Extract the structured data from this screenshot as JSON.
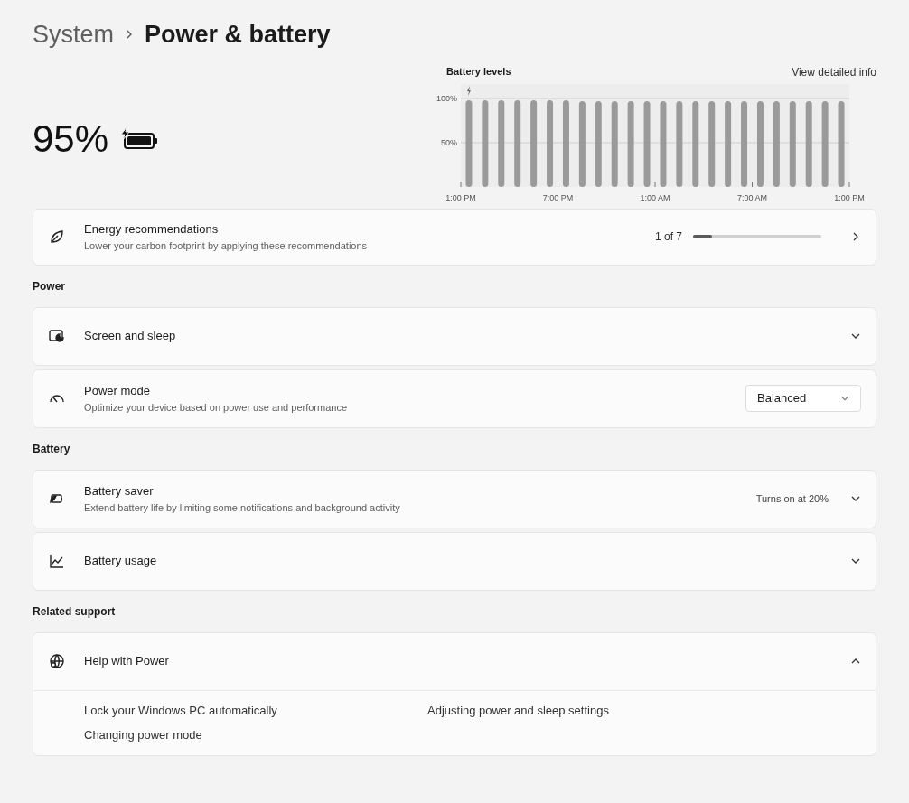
{
  "breadcrumb": {
    "parent": "System",
    "current": "Power & battery"
  },
  "battery": {
    "percent": "95%",
    "charging": true
  },
  "battery_levels": {
    "link": "View detailed info",
    "chart_data": {
      "type": "bar",
      "title": "Battery levels",
      "categories": [
        "1:00 PM",
        null,
        null,
        null,
        null,
        null,
        "7:00 PM",
        null,
        null,
        null,
        null,
        null,
        "1:00 AM",
        null,
        null,
        null,
        null,
        null,
        "7:00 AM",
        null,
        null,
        null,
        null,
        null,
        "1:00 PM"
      ],
      "values": [
        98,
        98,
        98,
        98,
        98,
        98,
        98,
        97,
        97,
        97,
        97,
        97,
        97,
        97,
        97,
        97,
        97,
        97,
        97,
        97,
        97,
        97,
        97,
        97,
        null
      ],
      "ylim": [
        0,
        100
      ],
      "yticks": [
        {
          "value": 50,
          "label": "50%"
        },
        {
          "value": 100,
          "label": "100%"
        }
      ]
    }
  },
  "energy": {
    "title": "Energy recommendations",
    "subtitle": "Lower your carbon footprint by applying these recommendations",
    "count": "1 of 7",
    "level": 0.15
  },
  "sections": [
    {
      "heading": "Power",
      "items": [
        {
          "kind": "expander",
          "title": "Screen and sleep",
          "expanded": false
        },
        {
          "kind": "dropdown",
          "title": "Power mode",
          "subtitle": "Optimize your device based on power use and performance",
          "value": "Balanced"
        }
      ]
    },
    {
      "heading": "Battery",
      "items": [
        {
          "kind": "expander",
          "title": "Battery saver",
          "subtitle": "Extend battery life by limiting some notifications and background activity",
          "status": "Turns on at 20%",
          "expanded": false
        },
        {
          "kind": "expander",
          "title": "Battery usage",
          "expanded": false
        }
      ]
    },
    {
      "heading": "Related support",
      "items": [
        {
          "kind": "expander",
          "title": "Help with Power",
          "expanded": true,
          "links": [
            "Lock your Windows PC automatically",
            "Adjusting power and sleep settings",
            "Changing power mode"
          ]
        }
      ]
    }
  ]
}
